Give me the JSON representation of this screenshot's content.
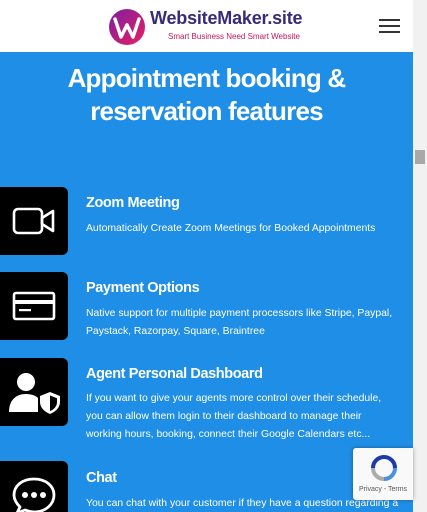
{
  "header": {
    "logo_name": "WebsiteMaker.site",
    "logo_tagline": "Smart Business Need Smart Website",
    "menu_icon": "hamburger-menu-icon"
  },
  "colors": {
    "section_background": "#1f8ee6",
    "icon_tile": "#000000",
    "logo_purple": "#3a2a7a",
    "logo_pink": "#c2185b"
  },
  "section": {
    "heading_line1": "Appointment booking &",
    "heading_line2": "reservation features"
  },
  "features": [
    {
      "icon": "video-camera-icon",
      "title": "Zoom Meeting",
      "lines": [
        "Automatically Create Zoom Meetings for Booked Appointments"
      ]
    },
    {
      "icon": "credit-card-icon",
      "title": "Payment Options",
      "lines": [
        "Native support for multiple payment processors like Stripe, Paypal,",
        "Paystack, Razorpay, Square, Braintree"
      ]
    },
    {
      "icon": "user-shield-icon",
      "title": "Agent Personal Dashboard",
      "lines": [
        "If you want to give your agents more control over their schedule,",
        "you can allow them login to their dashboard to manage their",
        "working hours, booking, connect their Google Calendars etc..."
      ]
    },
    {
      "icon": "chat-bubble-icon",
      "title": "Chat",
      "lines": [
        "You can chat with your customer if they have a question regarding a"
      ]
    }
  ],
  "recaptcha": {
    "links": "Privacy - Terms"
  }
}
